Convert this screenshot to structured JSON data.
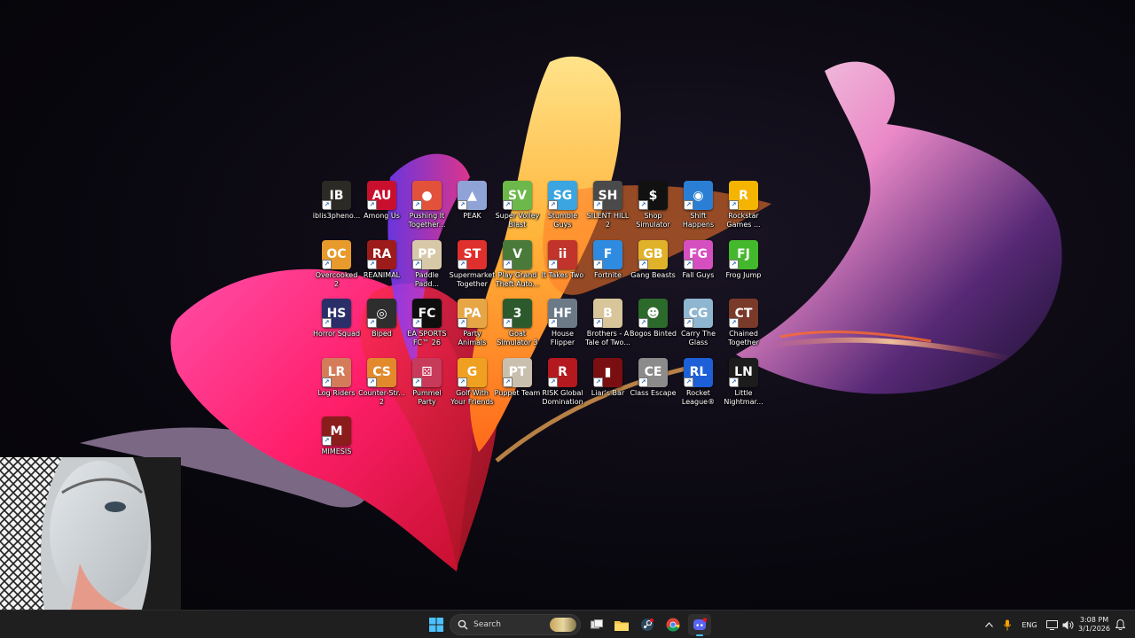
{
  "desktop": {
    "icons": [
      {
        "label": "iblis3pheno...",
        "icon": "iblis-icon",
        "color": "#2b2a24",
        "glyph": "IB"
      },
      {
        "label": "Among Us",
        "icon": "among-us-icon",
        "color": "#c8102e",
        "glyph": "AU"
      },
      {
        "label": "Pushing It Together...",
        "icon": "pushing-it-together-icon",
        "color": "#e2523a",
        "glyph": "●"
      },
      {
        "label": "PEAK",
        "icon": "peak-icon",
        "color": "#8fa3d6",
        "glyph": "▲"
      },
      {
        "label": "Super Volley Blast",
        "icon": "super-volley-blast-icon",
        "color": "#6cb84a",
        "glyph": "SV"
      },
      {
        "label": "Stumble Guys",
        "icon": "stumble-guys-icon",
        "color": "#3aa5e0",
        "glyph": "SG"
      },
      {
        "label": "SILENT HILL 2",
        "icon": "silent-hill-2-icon",
        "color": "#4a4a4a",
        "glyph": "SH"
      },
      {
        "label": "Shop Simulator",
        "icon": "shop-simulator-icon",
        "color": "#111111",
        "glyph": "$"
      },
      {
        "label": "Shift Happens",
        "icon": "shift-happens-icon",
        "color": "#2a7fd4",
        "glyph": "◉"
      },
      {
        "label": "Rockstar Games ...",
        "icon": "rockstar-games-icon",
        "color": "#f4b400",
        "glyph": "R"
      },
      {
        "label": "Overcooked 2",
        "icon": "overcooked-2-icon",
        "color": "#e89a2c",
        "glyph": "OC"
      },
      {
        "label": "REANIMAL",
        "icon": "reanimal-icon",
        "color": "#9e1b1b",
        "glyph": "RA"
      },
      {
        "label": "Paddle Padd...",
        "icon": "paddle-paddle-icon",
        "color": "#d7c9a8",
        "glyph": "PP"
      },
      {
        "label": "Supermarket Together",
        "icon": "supermarket-together-icon",
        "color": "#e0302d",
        "glyph": "ST"
      },
      {
        "label": "Play Grand Theft Auto...",
        "icon": "gta-icon",
        "color": "#4a7a3a",
        "glyph": "V"
      },
      {
        "label": "It Takes Two",
        "icon": "it-takes-two-icon",
        "color": "#c0342b",
        "glyph": "ii"
      },
      {
        "label": "Fortnite",
        "icon": "fortnite-icon",
        "color": "#2f8be0",
        "glyph": "F"
      },
      {
        "label": "Gang Beasts",
        "icon": "gang-beasts-icon",
        "color": "#e0b22a",
        "glyph": "GB"
      },
      {
        "label": "Fall Guys",
        "icon": "fall-guys-icon",
        "color": "#d64fc0",
        "glyph": "FG"
      },
      {
        "label": "Frog Jump",
        "icon": "frog-jump-icon",
        "color": "#44b82c",
        "glyph": "FJ"
      },
      {
        "label": "Horror Squad",
        "icon": "horror-squad-icon",
        "color": "#2a2f6a",
        "glyph": "HS"
      },
      {
        "label": "Biped",
        "icon": "biped-icon",
        "color": "#2e2e2e",
        "glyph": "◎"
      },
      {
        "label": "EA SPORTS FC™ 26",
        "icon": "ea-sports-fc-icon",
        "color": "#0e0e0e",
        "glyph": "FC"
      },
      {
        "label": "Party Animals",
        "icon": "party-animals-icon",
        "color": "#e6a646",
        "glyph": "PA"
      },
      {
        "label": "Goat Simulator 3",
        "icon": "goat-simulator-3-icon",
        "color": "#2c5a2c",
        "glyph": "3"
      },
      {
        "label": "House Flipper",
        "icon": "house-flipper-icon",
        "color": "#6c7a88",
        "glyph": "HF"
      },
      {
        "label": "Brothers - A Tale of Two...",
        "icon": "brothers-icon",
        "color": "#d8c69a",
        "glyph": "B"
      },
      {
        "label": "Bogos Binted",
        "icon": "bogos-binted-icon",
        "color": "#2c6a2c",
        "glyph": "☻"
      },
      {
        "label": "Carry The Glass",
        "icon": "carry-the-glass-icon",
        "color": "#8fb6d0",
        "glyph": "CG"
      },
      {
        "label": "Chained Together",
        "icon": "chained-together-icon",
        "color": "#7a3a2a",
        "glyph": "CT"
      },
      {
        "label": "Log Riders",
        "icon": "log-riders-icon",
        "color": "#d47b5a",
        "glyph": "LR"
      },
      {
        "label": "Counter-Str... 2",
        "icon": "counter-strike-2-icon",
        "color": "#e2892c",
        "glyph": "CS"
      },
      {
        "label": "Pummel Party",
        "icon": "pummel-party-icon",
        "color": "#c83a5a",
        "glyph": "⚄"
      },
      {
        "label": "Golf With Your Friends",
        "icon": "golf-with-your-friends-icon",
        "color": "#f0a020",
        "glyph": "G"
      },
      {
        "label": "Puppet Team",
        "icon": "puppet-team-icon",
        "color": "#c9bfae",
        "glyph": "PT"
      },
      {
        "label": "RISK Global Domination",
        "icon": "risk-icon",
        "color": "#b3191e",
        "glyph": "R"
      },
      {
        "label": "Liar's Bar",
        "icon": "liars-bar-icon",
        "color": "#7a0f12",
        "glyph": "▮"
      },
      {
        "label": "Class Escape",
        "icon": "class-escape-icon",
        "color": "#8b8b8b",
        "glyph": "CE"
      },
      {
        "label": "Rocket League®",
        "icon": "rocket-league-icon",
        "color": "#1d5fd6",
        "glyph": "RL"
      },
      {
        "label": "Little Nightmar...",
        "icon": "little-nightmares-icon",
        "color": "#1c1c1c",
        "glyph": "LN"
      },
      {
        "label": "MIMESIS",
        "icon": "mimesis-icon",
        "color": "#8a1c1c",
        "glyph": "M"
      }
    ]
  },
  "taskbar": {
    "search_placeholder": "Search",
    "apps": [
      {
        "name": "start-button",
        "icon": "windows-icon"
      },
      {
        "name": "search-widget",
        "icon": "highlight-icon"
      },
      {
        "name": "task-view",
        "icon": "task-view-icon"
      },
      {
        "name": "file-explorer",
        "icon": "folder-icon"
      },
      {
        "name": "steam",
        "icon": "steam-icon"
      },
      {
        "name": "chrome",
        "icon": "chrome-icon"
      },
      {
        "name": "discord",
        "icon": "discord-icon"
      }
    ],
    "tray": {
      "language": "ENG",
      "time": "3:08 PM",
      "date": "3/1/2026"
    }
  },
  "colors": {
    "taskbar_bg": "#1f1f1f",
    "accent": "#4cc2ff"
  }
}
